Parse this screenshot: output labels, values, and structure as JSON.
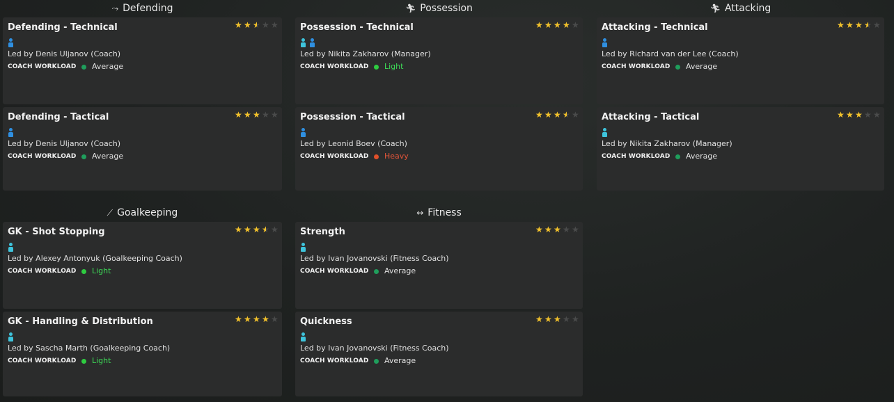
{
  "sections": {
    "defending": {
      "title": "Defending",
      "icon": "defending-slide-icon"
    },
    "possession": {
      "title": "Possession",
      "icon": "possession-run-icon"
    },
    "attacking": {
      "title": "Attacking",
      "icon": "attacking-run-icon"
    },
    "goalkeeping": {
      "title": "Goalkeeping",
      "icon": "goalkeeping-dive-icon"
    },
    "fitness": {
      "title": "Fitness",
      "icon": "fitness-dumbbell-icon"
    }
  },
  "workload_label": "COACH WORKLOAD",
  "workload_colors": {
    "Average": "#1f9e5c",
    "Light": "#2ecc40",
    "Heavy": "#e0502a"
  },
  "workload_text_colors": {
    "Average": "#e0e0e0",
    "Light": "#3ddc57",
    "Heavy": "#e4553a"
  },
  "cards": [
    {
      "title": "Defending - Technical",
      "rating": 2.5,
      "coaches": [
        "blue"
      ],
      "led_by": "Led by Denis Uljanov (Coach)",
      "workload": "Average"
    },
    {
      "title": "Defending - Tactical",
      "rating": 3,
      "coaches": [
        "blue"
      ],
      "led_by": "Led by Denis Uljanov (Coach)",
      "workload": "Average"
    },
    {
      "title": "Possession - Technical",
      "rating": 4,
      "coaches": [
        "cyan",
        "blue"
      ],
      "led_by": "Led by Nikita Zakharov (Manager)",
      "workload": "Light"
    },
    {
      "title": "Possession - Tactical",
      "rating": 3.5,
      "coaches": [
        "blue"
      ],
      "led_by": "Led by Leonid Boev (Coach)",
      "workload": "Heavy"
    },
    {
      "title": "Attacking - Technical",
      "rating": 3.5,
      "coaches": [
        "blue"
      ],
      "led_by": "Led by Richard van der Lee (Coach)",
      "workload": "Average"
    },
    {
      "title": "Attacking - Tactical",
      "rating": 3,
      "coaches": [
        "cyan"
      ],
      "led_by": "Led by Nikita Zakharov (Manager)",
      "workload": "Average"
    },
    {
      "title": "GK - Shot Stopping",
      "rating": 3.5,
      "coaches": [
        "cyan"
      ],
      "led_by": "Led by Alexey Antonyuk (Goalkeeping Coach)",
      "workload": "Light"
    },
    {
      "title": "GK - Handling & Distribution",
      "rating": 4,
      "coaches": [
        "cyan"
      ],
      "led_by": "Led by Sascha Marth (Goalkeeping Coach)",
      "workload": "Light"
    },
    {
      "title": "Strength",
      "rating": 3,
      "coaches": [
        "cyan"
      ],
      "led_by": "Led by Ivan Jovanovski (Fitness Coach)",
      "workload": "Average"
    },
    {
      "title": "Quickness",
      "rating": 3,
      "coaches": [
        "cyan"
      ],
      "led_by": "Led by Ivan Jovanovski (Fitness Coach)",
      "workload": "Average"
    }
  ]
}
